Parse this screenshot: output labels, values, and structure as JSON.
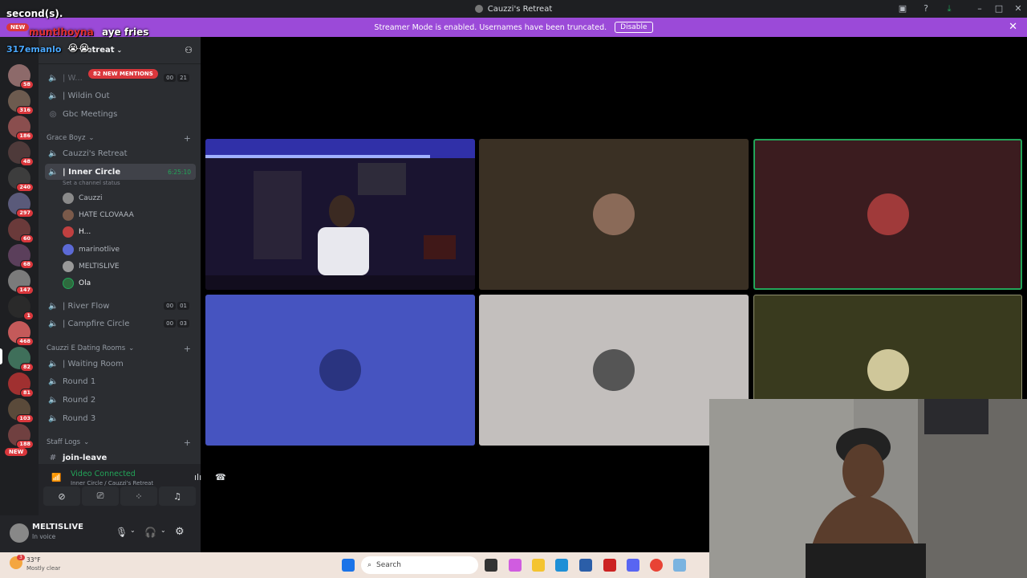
{
  "window": {
    "title": "Cauzzi's Retreat"
  },
  "banner": {
    "text": "Streamer Mode is enabled. Usernames have been truncated.",
    "disable_label": "Disable",
    "color": "#9b4ad8"
  },
  "overlay": {
    "top_line": "second(s).",
    "chat_name": "muntlhoyna",
    "chat_msg": "aye fries",
    "chat_name2": "317emanlo",
    "chat_emoji": "😭😭",
    "new_label": "NEW"
  },
  "server": {
    "name": "Retreat"
  },
  "rail": {
    "badges": [
      "58",
      "316",
      "186",
      "48",
      "240",
      "297",
      "60",
      "68",
      "147",
      "1",
      "468",
      "82",
      "81",
      "103",
      "188"
    ],
    "new_label": "NEW"
  },
  "mentions": {
    "label": "82 NEW MENTIONS"
  },
  "channels": {
    "top": [
      {
        "name": "| W...",
        "counts": [
          "00",
          "21"
        ]
      },
      {
        "name": "| Wildin Out"
      },
      {
        "name": "Gbc Meetings"
      }
    ],
    "cat1": "Grace Boyz",
    "grace": [
      {
        "name": "Cauzzi's Retreat"
      },
      {
        "name": "| Inner Circle",
        "time": "6:25:10",
        "status": "Set a channel status"
      }
    ],
    "users": [
      "Cauzzi",
      "HATE CLOVAAA",
      "H...",
      "marinotlive",
      "MELTISLIVE",
      "Ola"
    ],
    "more": [
      {
        "name": "| River Flow",
        "counts": [
          "00",
          "01"
        ]
      },
      {
        "name": "| Campfire Circle",
        "counts": [
          "00",
          "03"
        ]
      }
    ],
    "cat2": "Cauzzi E Dating Rooms",
    "dating": [
      "| Waiting Room",
      "Round 1",
      "Round 2",
      "Round 3"
    ],
    "cat3": "Staff Logs",
    "staff": [
      "join-leave"
    ]
  },
  "voice": {
    "status": "Video Connected",
    "location": "Inner Circle / Cauzzi's Retreat"
  },
  "user": {
    "name": "MELTISLIVE",
    "status": "In voice"
  },
  "tiles": [
    {
      "bg": "#1a1430"
    },
    {
      "bg": "#3a3024"
    },
    {
      "bg": "#3b1c1f"
    },
    {
      "bg": "#4654c0"
    },
    {
      "bg": "#c3bfbd"
    },
    {
      "bg": "#393a1e"
    }
  ],
  "taskbar": {
    "weather_temp": "33°F",
    "weather_desc": "Mostly clear",
    "search_placeholder": "Search",
    "badge": "3"
  }
}
